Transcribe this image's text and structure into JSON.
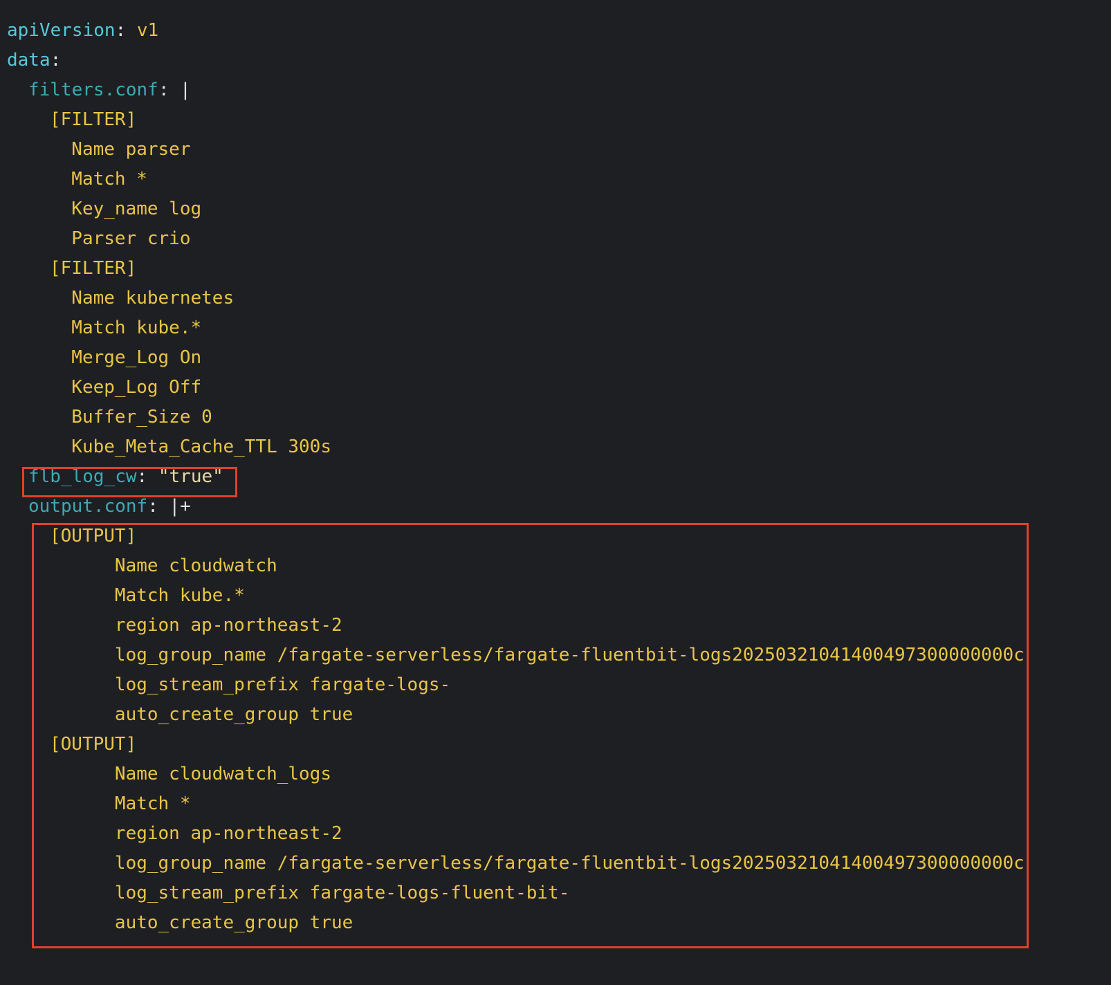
{
  "colors": {
    "background": "#1e1f22",
    "key": "#56c9d9",
    "nested_key": "#3fa9b5",
    "value": "#e8c547",
    "highlight": "#e0412c"
  },
  "yaml": {
    "apiVersion": {
      "key": "apiVersion",
      "sep": ":",
      "value": " v1"
    },
    "data_key": {
      "key": "data",
      "sep": ":"
    },
    "filters_conf": {
      "key": "filters.conf",
      "sep": ": |"
    },
    "filter_lines": [
      "[FILTER]",
      "  Name parser",
      "  Match *",
      "  Key_name log",
      "  Parser crio",
      "[FILTER]",
      "  Name kubernetes",
      "  Match kube.*",
      "  Merge_Log On",
      "  Keep_Log Off",
      "  Buffer_Size 0",
      "  Kube_Meta_Cache_TTL 300s"
    ],
    "flb_log_cw": {
      "key": "flb_log_cw",
      "sep": ": ",
      "value": "\"true\""
    },
    "output_conf": {
      "key": "output.conf",
      "sep": ": |+"
    },
    "output_lines": [
      "[OUTPUT]",
      "      Name cloudwatch",
      "      Match kube.*",
      "      region ap-northeast-2",
      "      log_group_name /fargate-serverless/fargate-fluentbit-logs20250321041400497300000000c",
      "      log_stream_prefix fargate-logs-",
      "      auto_create_group true",
      "[OUTPUT]",
      "      Name cloudwatch_logs",
      "      Match *",
      "      region ap-northeast-2",
      "      log_group_name /fargate-serverless/fargate-fluentbit-logs20250321041400497300000000c",
      "      log_stream_prefix fargate-logs-fluent-bit-",
      "      auto_create_group true"
    ]
  }
}
